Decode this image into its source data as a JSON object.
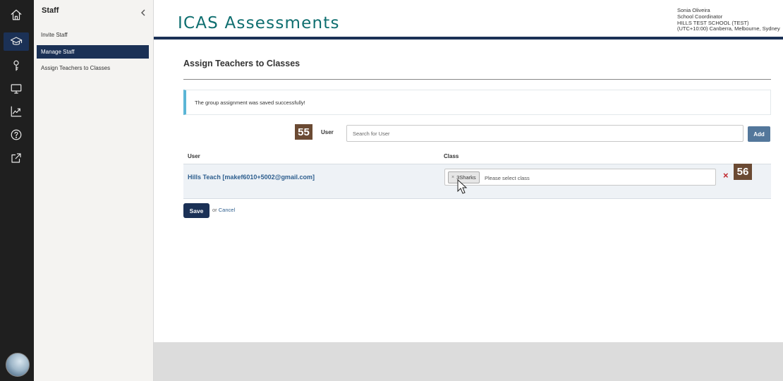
{
  "rail": {
    "items": [
      "home-icon",
      "graduation-cap-icon",
      "key-icon",
      "monitor-icon",
      "trend-chart-icon",
      "help-icon",
      "external-link-icon"
    ],
    "active_index": 1
  },
  "sidebar": {
    "title": "Staff",
    "items": [
      {
        "label": "Invite Staff"
      },
      {
        "label": "Manage Staff"
      },
      {
        "label": "Assign Teachers to Classes"
      }
    ],
    "active_item": "Manage Staff"
  },
  "header": {
    "brand": "ICAS Assessments",
    "user_name": "Sonia Oliveira",
    "user_role": "School Coordinator",
    "school": "HILLS TEST SCHOOL (TEST)",
    "timezone": "(UTC+10:00) Canberra, Melbourne, Sydney"
  },
  "main": {
    "page_title": "Assign Teachers to Classes",
    "alert": "The group assignment was saved successfully!",
    "badges": {
      "search": "55",
      "remove": "56"
    },
    "user_search": {
      "label": "User",
      "placeholder": "Search for User",
      "add_label": "Add"
    },
    "table": {
      "headers": {
        "user": "User",
        "class": "Class"
      },
      "rows": [
        {
          "user": "Hills Teach [makef6010+5002@gmail.com]",
          "tag": "3Sharks",
          "tag_remove": "×",
          "placeholder": "Please select class",
          "remove": "×"
        }
      ]
    },
    "actions": {
      "save": "Save",
      "or": "or",
      "cancel": "Cancel"
    }
  },
  "colors": {
    "navy": "#1b3156",
    "brand_teal": "#0e6e6f",
    "alert_accent": "#5bb6d6",
    "remove_red": "#c0262c",
    "badge_brown": "#6b4a33"
  }
}
